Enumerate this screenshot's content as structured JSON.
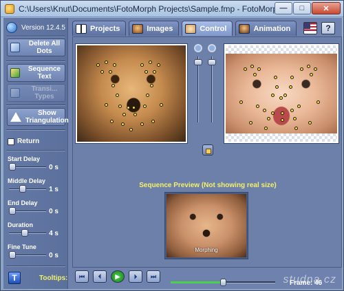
{
  "window": {
    "title": "C:\\Users\\Knut\\Documents\\FotoMorph Projects\\Sample.fmp - FotoMorph",
    "minimize": "—",
    "maximize": "□",
    "close": "✕"
  },
  "sidebar": {
    "version": "Version 12.4.5",
    "delete_all_dots": "Delete All Dots",
    "sequence_text": "Sequence Text",
    "transition_types": "Transi... Types",
    "show_triangulation": "Show Triangulation",
    "return_label": "Return",
    "return_checked": false,
    "sliders": [
      {
        "label": "Start Delay",
        "value": "0 s",
        "level": 0.0
      },
      {
        "label": "Middle Delay",
        "value": "1 s",
        "level": 0.35
      },
      {
        "label": "End Delay",
        "value": "0 s",
        "level": 0.0
      },
      {
        "label": "Duration",
        "value": "4 s",
        "level": 0.4
      },
      {
        "label": "Fine Tune",
        "value": "0 s",
        "level": 0.0
      }
    ],
    "tooltips_label": "Tooltips:",
    "tooltips_icon": "T"
  },
  "tabs": [
    {
      "label": "Projects",
      "icon": "film-icon",
      "active": false
    },
    {
      "label": "Images",
      "icon": "image-icon",
      "active": false
    },
    {
      "label": "Control",
      "icon": "face-icon",
      "active": true
    },
    {
      "label": "Animation",
      "icon": "animation-icon",
      "active": false
    }
  ],
  "help": "?",
  "main": {
    "preview_title": "Sequence Preview (Not showing real size)",
    "morph_label": "Morphing"
  },
  "transport": {
    "first": "⏮",
    "prev": "⏴",
    "play": "▶",
    "next": "⏵",
    "last": "⏭"
  },
  "frame": {
    "label": "Frame:",
    "value": "46",
    "progress": 0.5
  },
  "watermark": "studna.cz",
  "colors": {
    "accent": "#f5f06a",
    "panel": "#6d80aa",
    "dot": "#f5e23a"
  }
}
